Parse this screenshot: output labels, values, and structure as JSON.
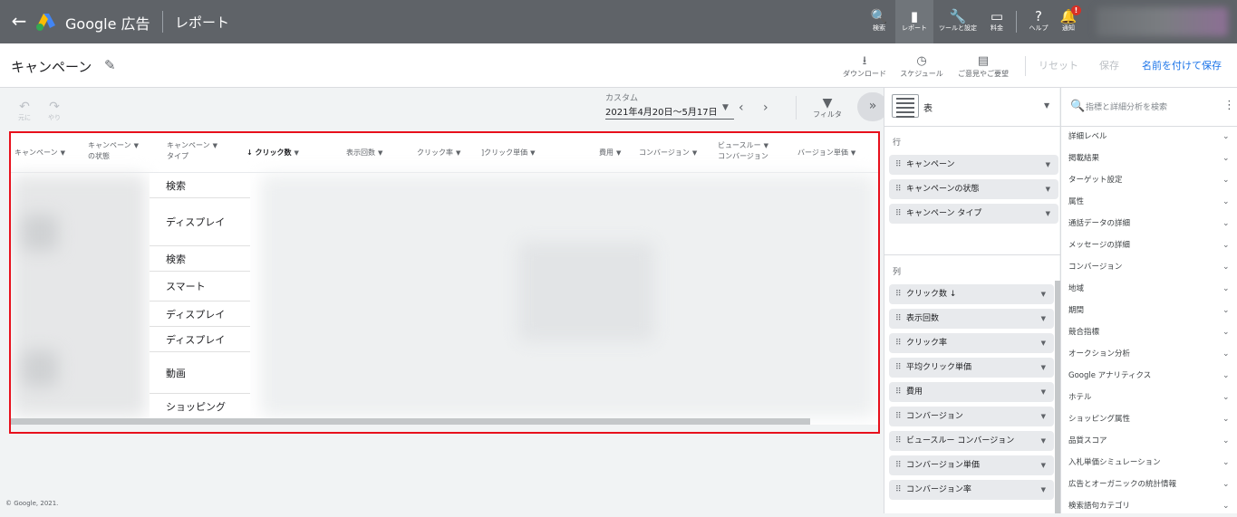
{
  "topbar": {
    "back": "←",
    "brand": "Google 広告",
    "page": "レポート",
    "buttons": [
      {
        "icon": "🔍",
        "label": "検索"
      },
      {
        "icon": "▮",
        "label": "レポート"
      },
      {
        "icon": "🔧",
        "label": "ツールと設定"
      },
      {
        "icon": "▭",
        "label": "料金"
      },
      {
        "icon": "?",
        "label": "ヘルプ"
      },
      {
        "icon": "🔔",
        "label": "通知"
      }
    ],
    "notif_badge": "!"
  },
  "subbar": {
    "title": "キャンペーン",
    "actions": [
      {
        "icon": "⭳",
        "label": "ダウンロード"
      },
      {
        "icon": "◷",
        "label": "スケジュール"
      },
      {
        "icon": "▤",
        "label": "ご意見やご要望"
      }
    ],
    "reset": "リセット",
    "save": "保存",
    "save_as": "名前を付けて保存"
  },
  "toolbar": {
    "undo": "元に",
    "redo": "やり",
    "date_label": "カスタム",
    "date_range": "2021年4月20日～5月17日",
    "filter": "フィルタ",
    "expand": "»"
  },
  "table": {
    "headers": [
      {
        "line1": "キャンペーン",
        "line2": ""
      },
      {
        "line1": "キャンペーン",
        "line2": "の状態"
      },
      {
        "line1": "キャンペーン",
        "line2": "タイプ"
      },
      {
        "line1": "↓ クリック数",
        "line2": ""
      },
      {
        "line1": "表示回数",
        "line2": ""
      },
      {
        "line1": "クリック率",
        "line2": ""
      },
      {
        "line1": "]クリック単価",
        "line2": ""
      },
      {
        "line1": "費用",
        "line2": ""
      },
      {
        "line1": "コンバージョン",
        "line2": ""
      },
      {
        "line1": "ビュースルー",
        "line2": "コンバージョン"
      },
      {
        "line1": "バージョン単価",
        "line2": ""
      }
    ],
    "types": [
      "検索",
      "ディスプレイ",
      "検索",
      "スマート",
      "ディスプレイ",
      "ディスプレイ",
      "動画",
      "ショッピング"
    ]
  },
  "footer": "© Google, 2021.",
  "panel": {
    "view_type": "表",
    "rows_label": "行",
    "rows": [
      "キャンペーン",
      "キャンペーンの状態",
      "キャンペーン タイプ"
    ],
    "cols_label": "列",
    "cols": [
      "クリック数 ↓",
      "表示回数",
      "クリック率",
      "平均クリック単価",
      "費用",
      "コンバージョン",
      "ビュースルー コンバージョン",
      "コンバージョン単価",
      "コンバージョン率"
    ]
  },
  "dimensions": {
    "search_placeholder": "指標と詳細分析を検索",
    "items": [
      "詳細レベル",
      "掲載結果",
      "ターゲット設定",
      "属性",
      "通話データの詳細",
      "メッセージの詳細",
      "コンバージョン",
      "地域",
      "期間",
      "競合指標",
      "オークション分析",
      "Google アナリティクス",
      "ホテル",
      "ショッピング属性",
      "品質スコア",
      "入札単価シミュレーション",
      "広告とオーガニックの統計情報",
      "検索語句カテゴリ"
    ]
  },
  "colors": {
    "topbar": "#5f6368",
    "accent": "#1a73e8",
    "highlight": "#e8101c"
  }
}
